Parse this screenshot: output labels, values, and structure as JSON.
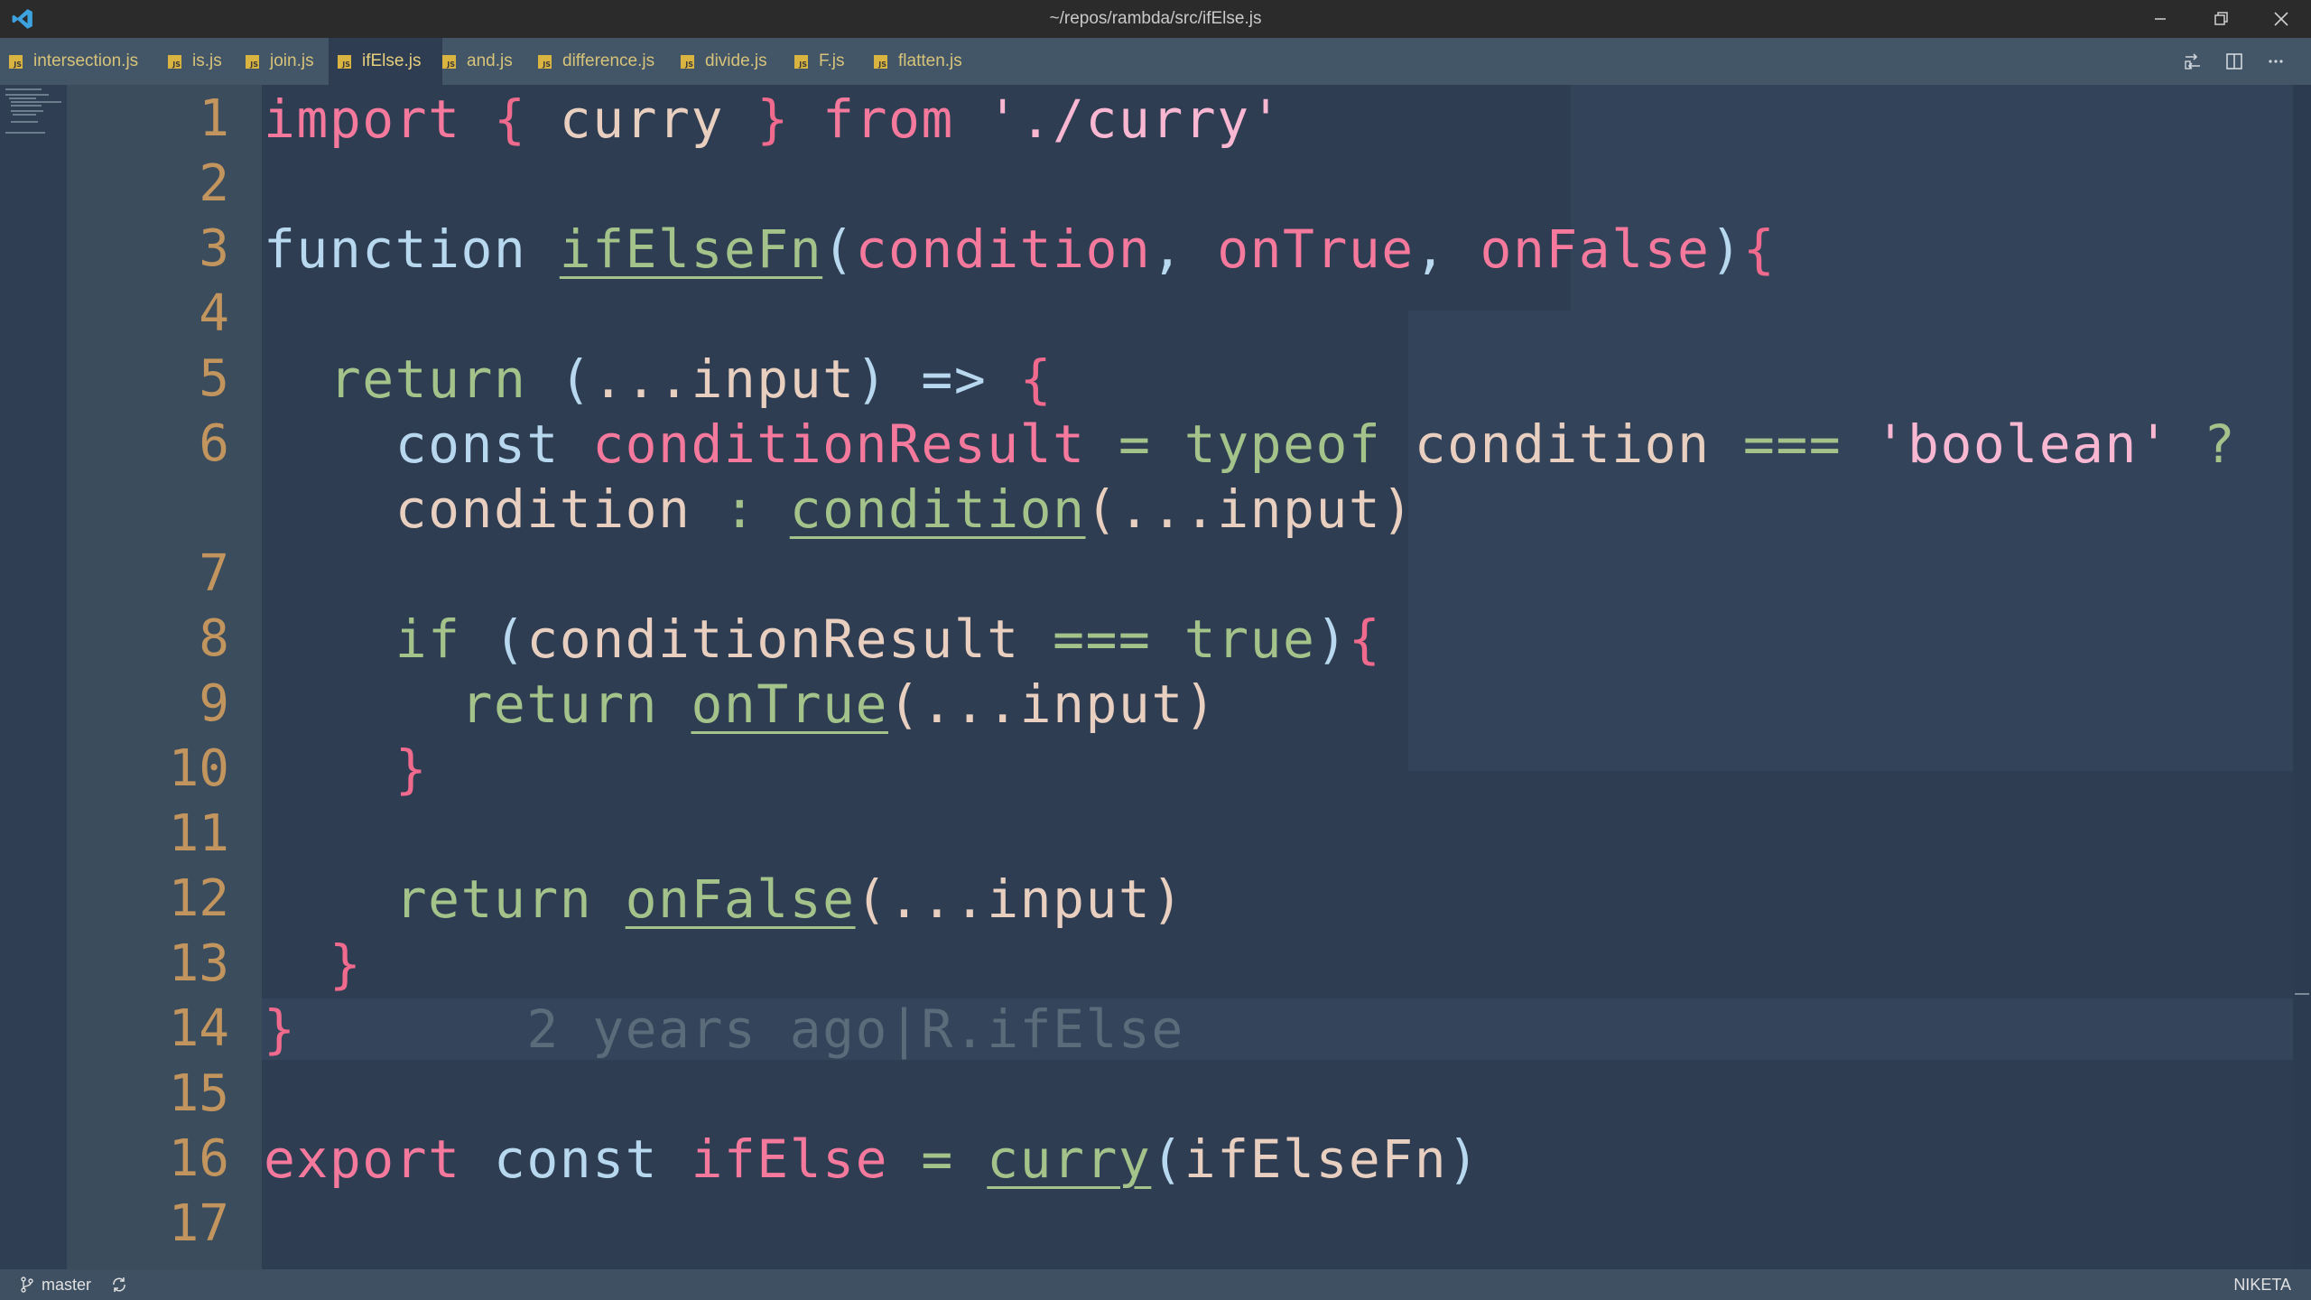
{
  "window": {
    "title": "~/repos/rambda/src/ifElse.js",
    "app_icon": "vscode-icon",
    "controls": [
      "minimize-icon",
      "restore-icon",
      "close-icon"
    ]
  },
  "tabs": [
    {
      "label": "intersection.js",
      "active": false
    },
    {
      "label": "is.js",
      "active": false
    },
    {
      "label": "join.js",
      "active": false
    },
    {
      "label": "ifElse.js",
      "active": true
    },
    {
      "label": "and.js",
      "active": false
    },
    {
      "label": "difference.js",
      "active": false
    },
    {
      "label": "divide.js",
      "active": false
    },
    {
      "label": "F.js",
      "active": false
    },
    {
      "label": "flatten.js",
      "active": false
    }
  ],
  "tab_actions": [
    "compare-changes-icon",
    "split-editor-icon",
    "more-actions-icon"
  ],
  "editor": {
    "line_numbers": [
      "1",
      "2",
      "3",
      "4",
      "5",
      "6",
      "7",
      "8",
      "9",
      "10",
      "11",
      "12",
      "13",
      "14",
      "15",
      "16",
      "17"
    ],
    "lines": {
      "l1": {
        "import": "import",
        "b1": "{",
        "curry": "curry",
        "b2": "}",
        "from": "from",
        "path": "'./curry'"
      },
      "l3": {
        "function": "function",
        "name": "ifElseFn",
        "open": "(",
        "p1": "condition",
        "c1": ",",
        "p2": "onTrue",
        "c2": ",",
        "p3": "onFalse",
        "close": ")",
        "brace": "{"
      },
      "l5": {
        "return": "return",
        "open": "(",
        "spread": "...input",
        "close": ")",
        "arrow": "=>",
        "brace": "{"
      },
      "l6": {
        "const": "const",
        "name": "conditionResult",
        "eq": "=",
        "typeof": "typeof",
        "cond": "condition",
        "teq": "===",
        "str": "'boolean'",
        "q": "?"
      },
      "l6b": {
        "cond": "condition",
        "colon": ":",
        "call": "condition",
        "args": "(...input)"
      },
      "l8": {
        "if": "if",
        "open": "(",
        "cond": "conditionResult",
        "teq": "===",
        "true": "true",
        "close": ")",
        "brace": "{"
      },
      "l9": {
        "return": "return",
        "call": "onTrue",
        "args": "(...input)"
      },
      "l10": {
        "brace": "}"
      },
      "l12": {
        "return": "return",
        "call": "onFalse",
        "args": "(...input)"
      },
      "l13": {
        "brace": "}"
      },
      "l14": {
        "brace": "}",
        "blame": "2 years ago|R.ifElse"
      },
      "l16": {
        "export": "export",
        "const": "const",
        "name": "ifElse",
        "eq": "=",
        "call": "curry",
        "open": "(",
        "arg": "ifElseFn",
        "close": ")"
      }
    }
  },
  "status": {
    "branch": "master",
    "user": "NIKETA"
  },
  "colors": {
    "background": "#2e3d52",
    "tabbar": "#435668",
    "line_numbers": "#c3955e",
    "keyword_pink": "#f5799c",
    "keyword_green": "#a3c38a",
    "keyword_blue": "#b7d8ef"
  }
}
